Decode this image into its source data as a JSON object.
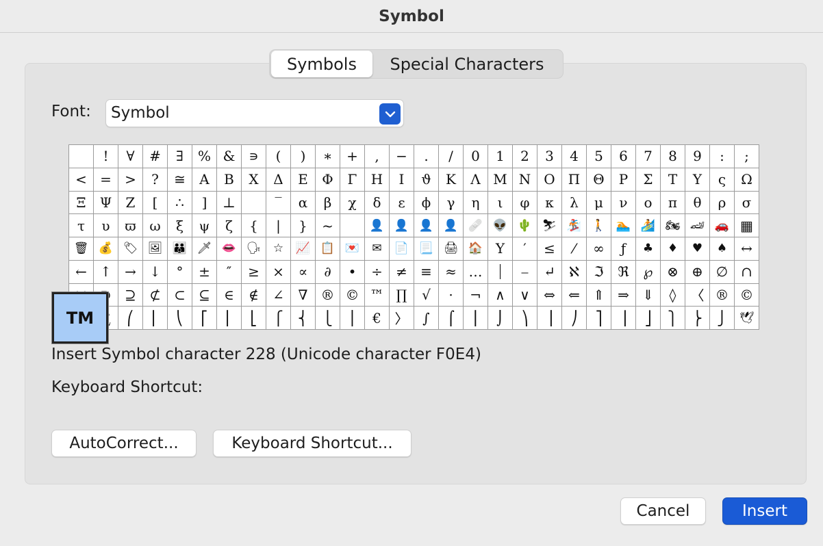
{
  "window": {
    "title": "Symbol"
  },
  "tabs": [
    {
      "label": "Symbols",
      "active": true
    },
    {
      "label": "Special Characters",
      "active": false
    }
  ],
  "font": {
    "label": "Font:",
    "value": "Symbol"
  },
  "symbol_grid": {
    "rows": [
      [
        " ",
        "!",
        "∀",
        "#",
        "∃",
        "%",
        "&",
        "∍",
        "(",
        ")",
        "∗",
        "+",
        ",",
        "−",
        ".",
        "/",
        "0",
        "1",
        "2",
        "3",
        "4",
        "5",
        "6",
        "7",
        "8",
        "9",
        ":",
        ";"
      ],
      [
        "<",
        "=",
        ">",
        "?",
        "≅",
        "Α",
        "Β",
        "Χ",
        "Δ",
        "Ε",
        "Φ",
        "Γ",
        "Η",
        "Ι",
        "ϑ",
        "Κ",
        "Λ",
        "Μ",
        "Ν",
        "Ο",
        "Π",
        "Θ",
        "Ρ",
        "Σ",
        "Τ",
        "Υ",
        "ς",
        "Ω"
      ],
      [
        "Ξ",
        "Ψ",
        "Ζ",
        "[",
        "∴",
        "]",
        "⊥",
        " ",
        "‾",
        "α",
        "β",
        "χ",
        "δ",
        "ε",
        "ϕ",
        "γ",
        "η",
        "ι",
        "φ",
        "κ",
        "λ",
        "μ",
        "ν",
        "ο",
        "π",
        "θ",
        "ρ",
        "σ"
      ],
      [
        "τ",
        "υ",
        "ϖ",
        "ω",
        "ξ",
        "ψ",
        "ζ",
        "{",
        "|",
        "}",
        "~",
        " ",
        "👤",
        "👤",
        "👤",
        "👤",
        "🩹",
        "👽",
        "🌵",
        "⛷",
        "🏂",
        "🚶",
        "🏊",
        "🏄",
        "🏍",
        "🏎",
        "🚗",
        "▦"
      ],
      [
        "🗑",
        "💰",
        "🏷",
        "🖼",
        "👪",
        "🗡",
        "👄",
        "🗣",
        "☆",
        "📈",
        "📋",
        "💌",
        "✉",
        "📄",
        "📃",
        "🖨",
        "🏠",
        "Υ",
        "′",
        "≤",
        "⁄",
        "∞",
        "ƒ",
        "♣",
        "♦",
        "♥",
        "♠",
        "↔"
      ],
      [
        "←",
        "↑",
        "→",
        "↓",
        "°",
        "±",
        "″",
        "≥",
        "×",
        "∝",
        "∂",
        "•",
        "÷",
        "≠",
        "≡",
        "≈",
        "…",
        "⏐",
        "⎯",
        "↵",
        "ℵ",
        "ℑ",
        "ℜ",
        "℘",
        "⊗",
        "⊕",
        "∅",
        "∩"
      ],
      [
        "∪",
        "⊃",
        "⊇",
        "⊄",
        "⊂",
        "⊆",
        "∈",
        "∉",
        "∠",
        "∇",
        "®",
        "©",
        "™",
        "∏",
        "√",
        "⋅",
        "¬",
        "∧",
        "∨",
        "⇔",
        "⇐",
        "⇑",
        "⇒",
        "⇓",
        "◊",
        "〈",
        "®",
        "©"
      ],
      [
        "™",
        "∑",
        "⎛",
        "⎜",
        "⎝",
        "⎡",
        "⎢",
        "⎣",
        "⎧",
        "⎨",
        "⎩",
        "⎪",
        "€",
        "〉",
        "∫",
        "⌠",
        "⎮",
        "⌡",
        "⎞",
        "⎟",
        "⎠",
        "⎤",
        "⎥",
        "⎦",
        "⎫",
        "⎬",
        "⎭",
        "🕊"
      ]
    ]
  },
  "selected_symbol": {
    "glyph": "TM"
  },
  "info": {
    "description": "Insert Symbol character 228  (Unicode character F0E4)",
    "shortcut_label": "Keyboard Shortcut:"
  },
  "buttons": {
    "autocorrect": "AutoCorrect...",
    "keyboard_shortcut": "Keyboard Shortcut...",
    "cancel": "Cancel",
    "insert": "Insert"
  },
  "colors": {
    "accent": "#1a5bd6",
    "selection": "#a8ccf7"
  },
  "icons": {
    "font_dropdown": "chevron-down-icon"
  }
}
